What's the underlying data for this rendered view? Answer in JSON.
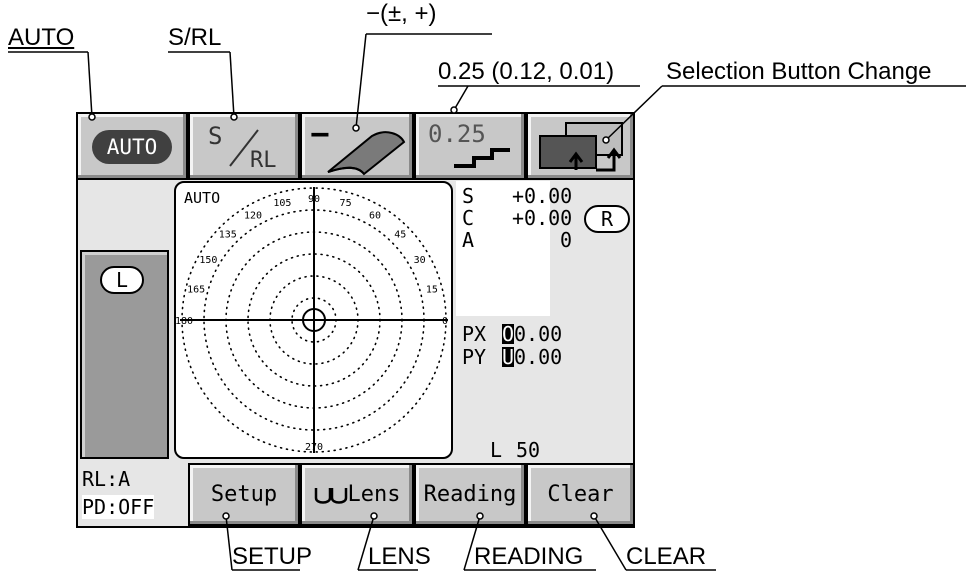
{
  "callouts": {
    "auto": "AUTO",
    "srl": "S/RL",
    "minus": "−(±, +)",
    "step": "0.25 (0.12, 0.01)",
    "selection": "Selection Button Change",
    "setup": "SETUP",
    "lens": "LENS",
    "reading": "READING",
    "clear": "CLEAR"
  },
  "toolbar": {
    "auto_label": "AUTO",
    "s_label": "S",
    "rl_label": "RL",
    "minus_label": "−",
    "step_label": "0.25"
  },
  "left_panel": {
    "eye_label": "L"
  },
  "chart": {
    "mode_label": "AUTO",
    "angle_labels": [
      "90",
      "105",
      "75",
      "120",
      "60",
      "135",
      "45",
      "150",
      "30",
      "165",
      "15",
      "180",
      "0",
      "270"
    ]
  },
  "readings": {
    "s_label": "S",
    "s_value": "+0.00",
    "c_label": "C",
    "c_value": "+0.00",
    "a_label": "A",
    "a_value": "0",
    "eye_label": "R",
    "px_label": "PX",
    "px_sign": "O",
    "px_value": "0.00",
    "py_label": "PY",
    "py_sign": "U",
    "py_value": "0.00",
    "l_label": "L",
    "l_value": "50"
  },
  "status": {
    "rl": "RL:A",
    "pd": "PD:OFF"
  },
  "bottom": {
    "setup": "Setup",
    "lens": "Lens",
    "reading": "Reading",
    "clear": "Clear"
  }
}
